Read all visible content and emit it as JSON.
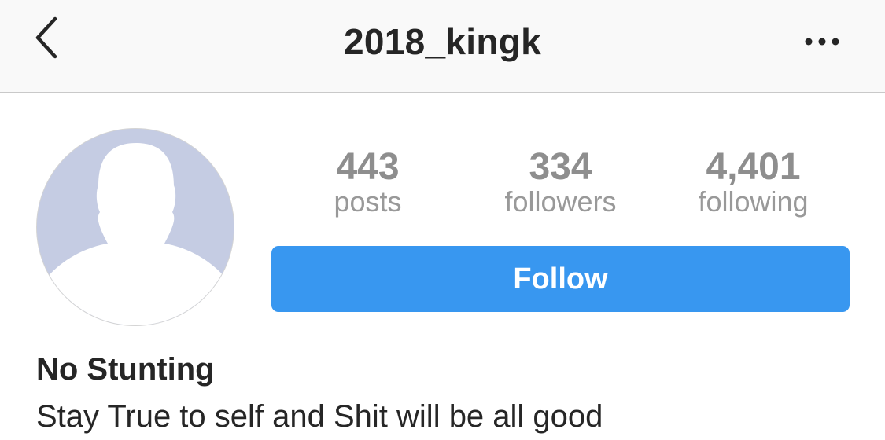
{
  "header": {
    "username": "2018_kingk",
    "back_icon": "chevron-left-icon",
    "more_icon": "ellipsis-icon"
  },
  "profile": {
    "avatar_icon": "default-person-icon",
    "stats": {
      "posts": {
        "value": "443",
        "label": "posts"
      },
      "followers": {
        "value": "334",
        "label": "followers"
      },
      "following": {
        "value": "4,401",
        "label": "following"
      }
    },
    "follow_label": "Follow",
    "name": "No Stunting",
    "bio": "Stay True to self and Shit will be all good"
  },
  "colors": {
    "follow_button": "#3897f0",
    "text_primary": "#262626",
    "text_secondary": "#999999",
    "avatar_bg": "#c5cce3"
  }
}
